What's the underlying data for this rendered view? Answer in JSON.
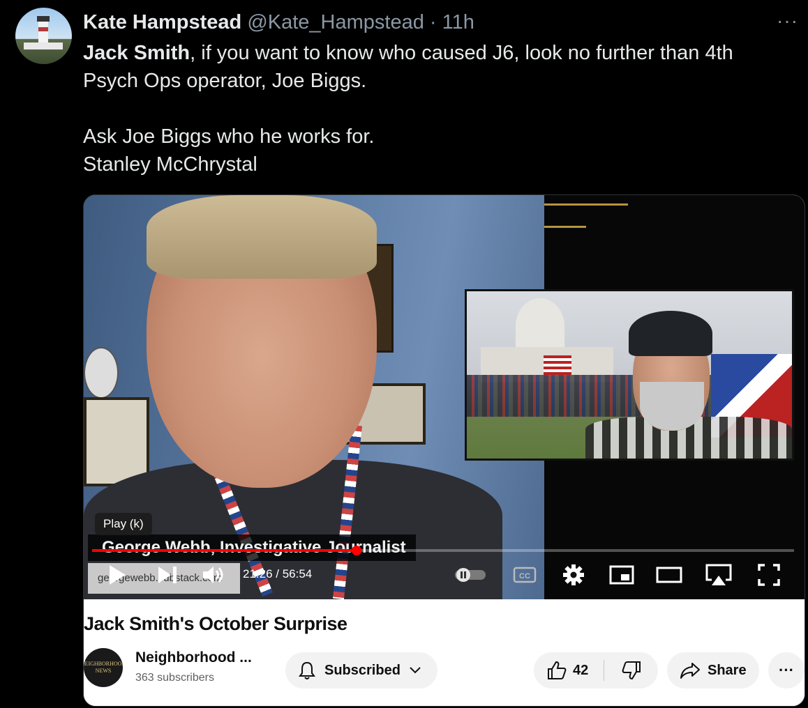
{
  "tweet": {
    "author_name": "Kate Hampstead",
    "handle": "@Kate_Hampstead",
    "separator": "·",
    "time": "11h",
    "more_label": "···",
    "mention": "Jack Smith",
    "line1_rest": ", if you want to know who caused J6, look no further than 4th Psych Ops operator, Joe Biggs.",
    "line2": "Ask Joe Biggs who he works for.",
    "line3": "Stanley McChrystal"
  },
  "video": {
    "tooltip": "Play (k)",
    "lower_third_name": "George Webb, Investigative Journalist",
    "lower_third_url": "georgewebb.substack.com",
    "current_time": "21:26",
    "duration": "56:54",
    "time_readout": "21:26 / 56:54",
    "progress_fraction": 0.3767,
    "title": "Jack Smith's October Surprise",
    "channel_name": "Neighborhood ...",
    "channel_avatar_text": "NEIGHBORHOOD NEWS",
    "subscribers": "363 subscribers",
    "subscribed_label": "Subscribed",
    "like_count": "42",
    "share_label": "Share",
    "more_label": "···",
    "cc_label": "CC",
    "accent_color": "#ff0000"
  }
}
